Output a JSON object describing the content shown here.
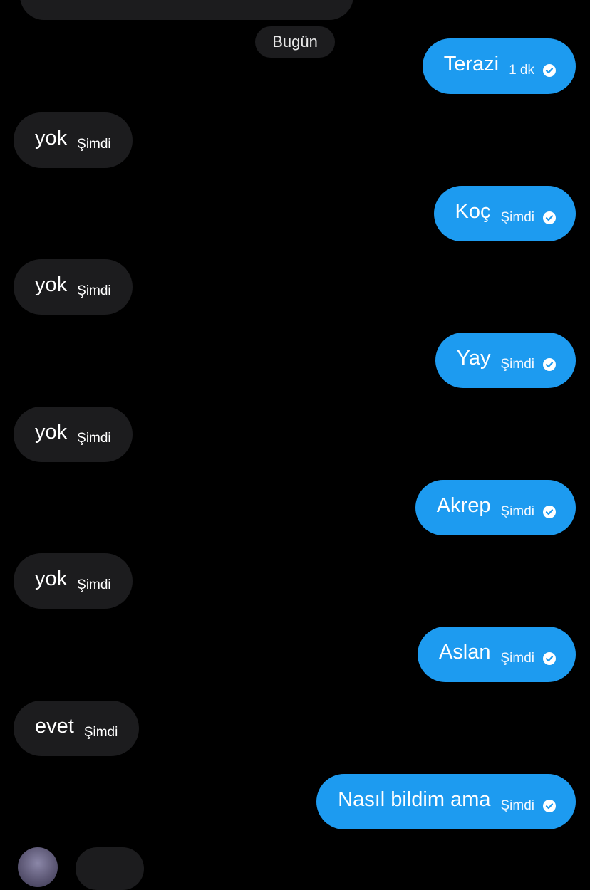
{
  "conversation": {
    "date_separator": "Bugün",
    "messages": [
      {
        "direction": "sent",
        "text": "Terazi",
        "time": "1 dk",
        "status_icon": "sent-check-icon"
      },
      {
        "direction": "received",
        "text": "yok",
        "time": "Şimdi"
      },
      {
        "direction": "sent",
        "text": "Koç",
        "time": "Şimdi",
        "status_icon": "sent-check-icon"
      },
      {
        "direction": "received",
        "text": "yok",
        "time": "Şimdi"
      },
      {
        "direction": "sent",
        "text": "Yay",
        "time": "Şimdi",
        "status_icon": "sent-check-icon"
      },
      {
        "direction": "received",
        "text": "yok",
        "time": "Şimdi"
      },
      {
        "direction": "sent",
        "text": "Akrep",
        "time": "Şimdi",
        "status_icon": "sent-check-icon"
      },
      {
        "direction": "received",
        "text": "yok",
        "time": "Şimdi"
      },
      {
        "direction": "sent",
        "text": "Aslan",
        "time": "Şimdi",
        "status_icon": "sent-check-icon"
      },
      {
        "direction": "received",
        "text": "evet",
        "time": "Şimdi"
      },
      {
        "direction": "sent",
        "text": "Nasıl bildim ama",
        "time": "Şimdi",
        "status_icon": "sent-check-icon"
      }
    ]
  },
  "colors": {
    "background": "#000000",
    "received_bubble": "#1c1c1e",
    "sent_bubble": "#1d9bf0",
    "text": "#ffffff"
  }
}
